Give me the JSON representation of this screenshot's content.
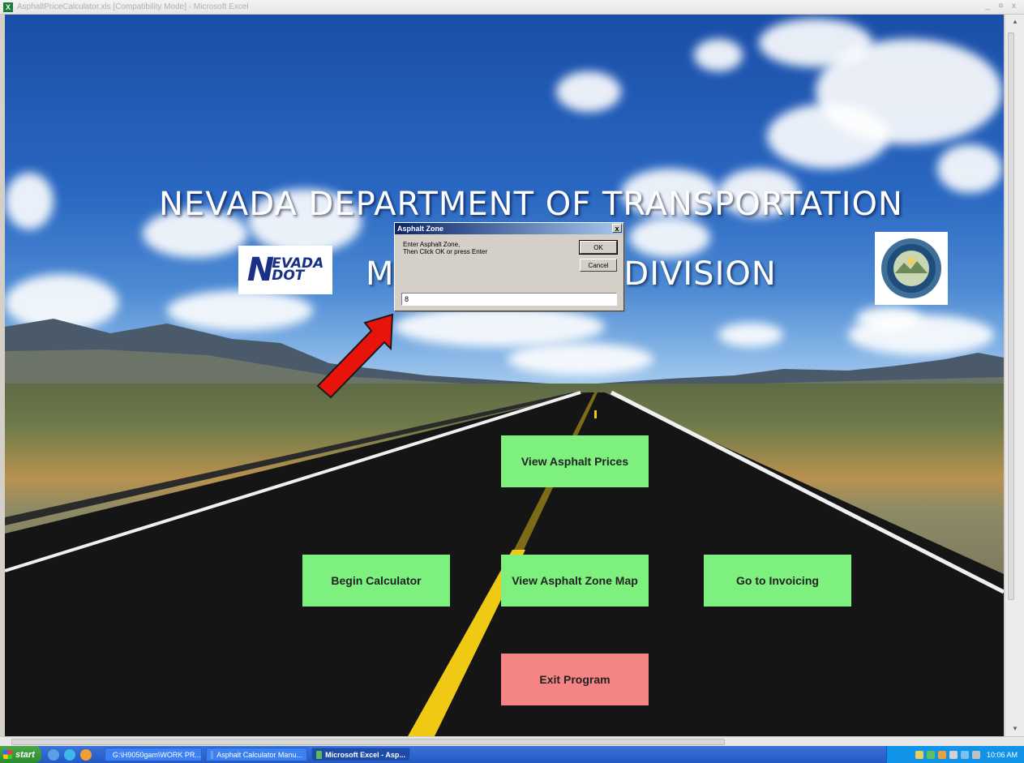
{
  "window": {
    "title": "AsphaltPriceCalculator.xls  [Compatibility Mode] - Microsoft Excel",
    "controls": "_ ¤ x"
  },
  "header": {
    "line1": "NEVADA DEPARTMENT OF TRANSPORTATION",
    "line2": "MAINTENANCE DIVISION"
  },
  "logos": {
    "ndot_big": "N",
    "ndot_top": "EVADA",
    "ndot_bottom": "DOT",
    "seal_icon": "nevada-state-seal"
  },
  "buttons": {
    "view_prices": "View Asphalt Prices",
    "begin_calculator": "Begin Calculator",
    "view_zone_map": "View Asphalt Zone Map",
    "go_to_invoicing": "Go to Invoicing",
    "exit_program": "Exit Program"
  },
  "dialog": {
    "title": "Asphalt Zone",
    "close": "x",
    "prompt_line1": "Enter Asphalt Zone,",
    "prompt_line2": "Then Click OK or press Enter",
    "ok": "OK",
    "cancel": "Cancel",
    "input_value": "8"
  },
  "taskbar": {
    "start": "start",
    "tasks": [
      "G:\\H9050gam\\WORK PR...",
      "Asphalt Calculator Manu...",
      "Microsoft Excel - Asp..."
    ],
    "clock": "10:06 AM"
  },
  "colors": {
    "button_green": "#7df07d",
    "button_red": "#f58584",
    "dialog_title": "#0a246a",
    "arrow": "#e8140c"
  }
}
